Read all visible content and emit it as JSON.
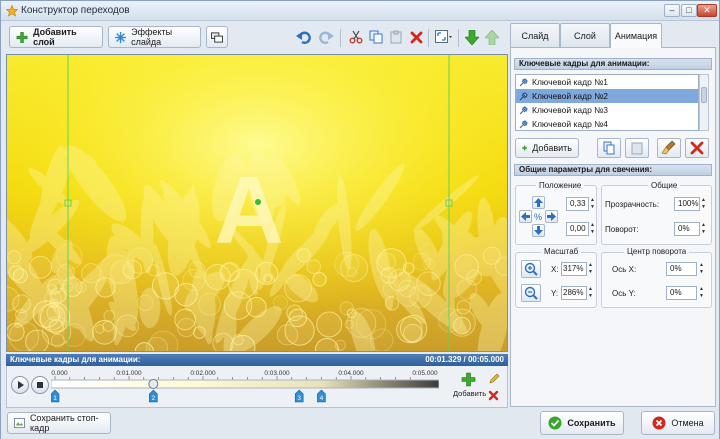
{
  "window": {
    "title": "Конструктор переходов"
  },
  "toolbar": {
    "add_layer": "Добавить слой",
    "slide_effects": "Эффекты слайда"
  },
  "tabs": [
    {
      "label": "Слайд"
    },
    {
      "label": "Слой"
    },
    {
      "label": "Анимация",
      "active": true
    }
  ],
  "keyframes": {
    "header": "Ключевые кадры для анимации:",
    "items": [
      "Ключевой кадр №1",
      "Ключевой кадр №2",
      "Ключевой кадр №3",
      "Ключевой кадр №4"
    ],
    "selected_index": 1,
    "add_label": "Добавить"
  },
  "params": {
    "header": "Общие параметры для свечения:",
    "position_label": "Положение",
    "pos_x": "0,33",
    "pos_y": "0,00",
    "general_label": "Общие",
    "opacity_label": "Прозрачность:",
    "opacity_value": "100%",
    "rotation_label": "Поворот:",
    "rotation_value": "0%",
    "scale_label": "Масштаб",
    "scale_x_label": "X:",
    "scale_x_value": "317%",
    "scale_y_label": "Y:",
    "scale_y_value": "286%",
    "pivot_label": "Центр поворота",
    "axis_x_label": "Ось X:",
    "axis_x_value": "0%",
    "axis_y_label": "Ось Y:",
    "axis_y_value": "0%"
  },
  "stage": {
    "letter": "A"
  },
  "timeline": {
    "header": "Ключевые кадры для анимации:",
    "time": "00:01.329 / 00:05.000",
    "ticks": [
      "0:00.000",
      "0:01.000",
      "0:02.000",
      "0:03.000",
      "0:04.000",
      "0:05.000"
    ],
    "markers": [
      "1",
      "2",
      "3",
      "4"
    ],
    "marker_times": [
      0.0,
      1.329,
      3.3,
      3.6
    ],
    "playhead_time": 1.329,
    "duration": 5.0,
    "add_label": "Добавить"
  },
  "footer": {
    "save_frame": "Сохранить стоп-кадр",
    "save": "Сохранить",
    "cancel": "Отмена"
  },
  "colors": {
    "accent": "#2f5f9d",
    "stage_yellow": "#f4d40c",
    "stage_orange": "#d9a020",
    "selection": "#7fa9dd"
  }
}
